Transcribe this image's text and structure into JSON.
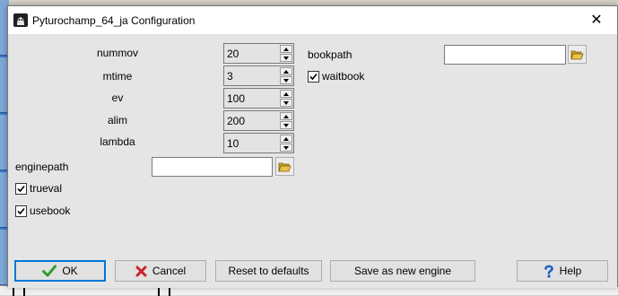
{
  "window": {
    "title": "Pyturochamp_64_ja Configuration",
    "close_glyph": "✕"
  },
  "fields": {
    "nummov": {
      "label": "nummov",
      "value": "20"
    },
    "mtime": {
      "label": "mtime",
      "value": "3"
    },
    "ev": {
      "label": "ev",
      "value": "100"
    },
    "alim": {
      "label": "alim",
      "value": "200"
    },
    "lambda": {
      "label": "lambda",
      "value": "10"
    },
    "bookpath": {
      "label": "bookpath",
      "value": ""
    },
    "waitbook": {
      "label": "waitbook",
      "checked": true
    },
    "enginepath": {
      "label": "enginepath",
      "value": ""
    },
    "trueval": {
      "label": "trueval",
      "checked": true
    },
    "usebook": {
      "label": "usebook",
      "checked": true
    }
  },
  "buttons": {
    "ok": "OK",
    "cancel": "Cancel",
    "reset": "Reset to defaults",
    "save_as_new": "Save as new engine",
    "help": "Help"
  },
  "icons": {
    "app": "app-chess-icon",
    "folder": "folder-open-icon",
    "check": "green-check-icon",
    "cancel": "red-x-icon",
    "help": "blue-question-icon"
  },
  "colors": {
    "accent": "#0078d7",
    "ok_check": "#2e9d2e",
    "cancel_x": "#c8242b",
    "help_q": "#1d5fc4",
    "folder": "#e8c34a"
  }
}
